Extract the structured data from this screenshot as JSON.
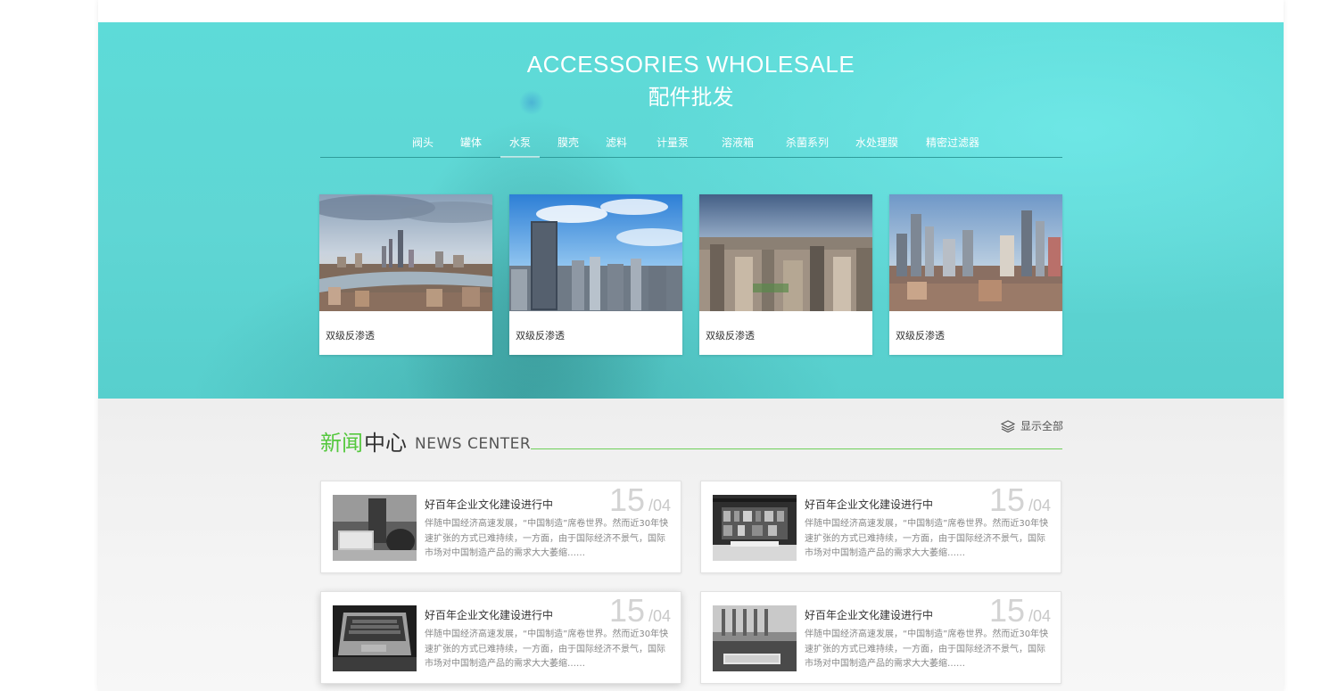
{
  "hero": {
    "title_en": "ACCESSORIES WHOLESALE",
    "title_cn": "配件批发"
  },
  "categories": [
    {
      "label": "阀头"
    },
    {
      "label": "罐体"
    },
    {
      "label": "水泵",
      "active": true
    },
    {
      "label": "膜壳"
    },
    {
      "label": "滤料"
    },
    {
      "label": "计量泵"
    },
    {
      "label": "溶液箱"
    },
    {
      "label": "杀菌系列"
    },
    {
      "label": "水处理膜"
    },
    {
      "label": "精密过滤器"
    }
  ],
  "products": [
    {
      "label": "双级反渗透",
      "image": "city-skyline-river"
    },
    {
      "label": "双级反渗透",
      "image": "city-skyline-tower"
    },
    {
      "label": "双级反渗透",
      "image": "city-skyline-dense"
    },
    {
      "label": "双级反渗透",
      "image": "city-skyline-towers"
    }
  ],
  "news": {
    "title_cn_accent": "新闻",
    "title_cn": "中心",
    "title_en": "NEWS CENTER",
    "show_all": "显示全部",
    "accent_color": "#55c83e",
    "items": [
      {
        "title": "好百年企业文化建设进行中",
        "day": "15",
        "month": "/04",
        "desc": "伴随中国经济高速发展，“中国制造”席卷世界。然而近30年快速扩张的方式已难持续，一方面，由于国际经济不景气，国际市场对中国制造产品的需求大大萎缩……",
        "image": "laptop-desk"
      },
      {
        "title": "好百年企业文化建设进行中",
        "day": "15",
        "month": "/04",
        "desc": "伴随中国经济高速发展，“中国制造”席卷世界。然而近30年快速扩张的方式已难持续，一方面，由于国际经济不景气，国际市场对中国制造产品的需求大大萎缩……",
        "image": "bookshelf-office"
      },
      {
        "title": "好百年企业文化建设进行中",
        "day": "15",
        "month": "/04",
        "desc": "伴随中国经济高速发展，“中国制造”席卷世界。然而近30年快速扩张的方式已难持续，一方面，由于国际经济不景气，国际市场对中国制造产品的需求大大萎缩……",
        "image": "laptop-keyboard"
      },
      {
        "title": "好百年企业文化建设进行中",
        "day": "15",
        "month": "/04",
        "desc": "伴随中国经济高速发展，“中国制造”席卷世界。然而近30年快速扩张的方式已难持续，一方面，由于国际经济不景气，国际市场对中国制造产品的需求大大萎缩……",
        "image": "keyboard-desk"
      }
    ]
  }
}
